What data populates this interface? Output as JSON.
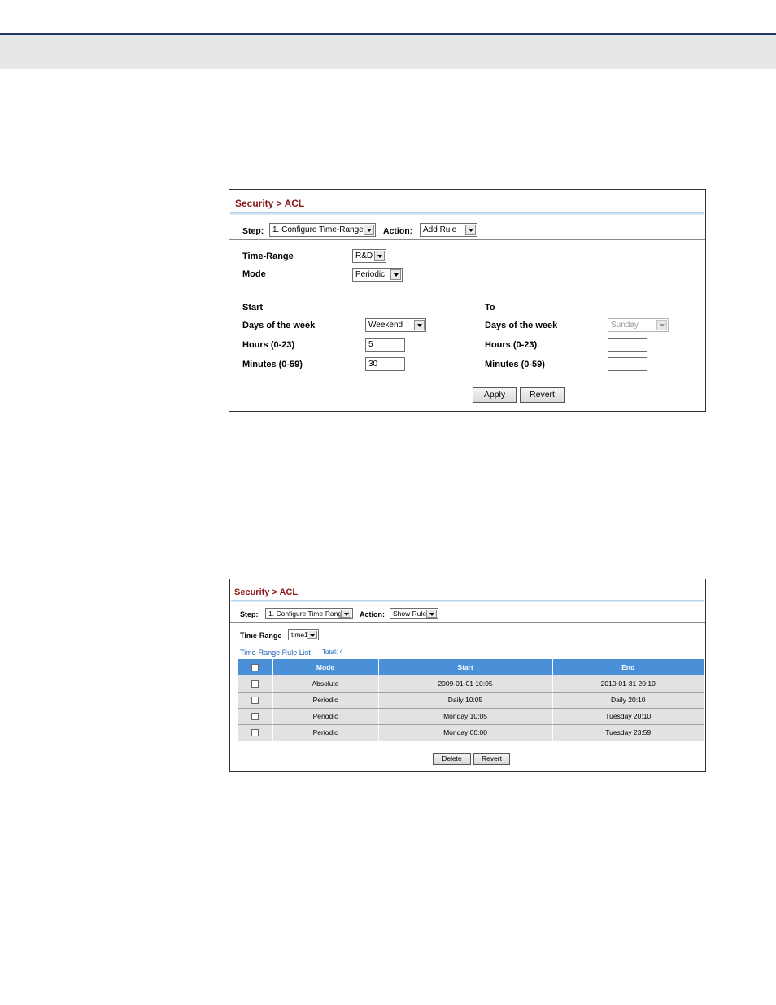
{
  "panel1": {
    "title": "Security > ACL",
    "step_label": "Step:",
    "step_value": "1. Configure Time-Range",
    "action_label": "Action:",
    "action_value": "Add Rule",
    "time_range_label": "Time-Range",
    "time_range_value": "R&D",
    "mode_label": "Mode",
    "mode_value": "Periodic",
    "start_heading": "Start",
    "to_heading": "To",
    "start": {
      "days_label": "Days of the week",
      "days_value": "Weekend",
      "hours_label": "Hours (0-23)",
      "hours_value": "5",
      "minutes_label": "Minutes (0-59)",
      "minutes_value": "30"
    },
    "to": {
      "days_label": "Days of the week",
      "days_value": "Sunday",
      "hours_label": "Hours (0-23)",
      "hours_value": "",
      "minutes_label": "Minutes (0-59)",
      "minutes_value": ""
    },
    "apply_label": "Apply",
    "revert_label": "Revert"
  },
  "panel2": {
    "title": "Security > ACL",
    "step_label": "Step:",
    "step_value": "1. Configure Time-Range",
    "action_label": "Action:",
    "action_value": "Show Rule",
    "time_range_label": "Time-Range",
    "time_range_value": "time1",
    "list_title": "Time-Range Rule List",
    "total": "Total: 4",
    "columns": [
      "Mode",
      "Start",
      "End"
    ],
    "rows": [
      [
        "Absolute",
        "2009-01-01 10:05",
        "2010-01-31 20:10"
      ],
      [
        "Periodic",
        "Daily 10:05",
        "Daily 20:10"
      ],
      [
        "Periodic",
        "Monday 10:05",
        "Tuesday 20:10"
      ],
      [
        "Periodic",
        "Monday 00:00",
        "Tuesday 23:59"
      ]
    ],
    "delete_label": "Delete",
    "revert_label": "Revert"
  }
}
